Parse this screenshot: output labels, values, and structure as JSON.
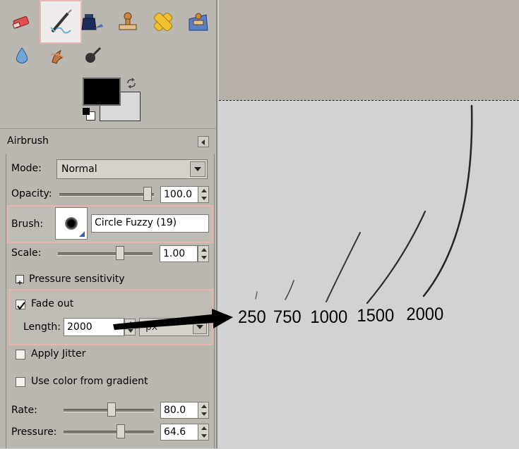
{
  "toolbox": {
    "tools": [
      {
        "name": "eraser-icon",
        "active": false
      },
      {
        "name": "airbrush-icon",
        "active": true
      },
      {
        "name": "ink-icon",
        "active": false
      },
      {
        "name": "clone-stamp-icon",
        "active": false
      },
      {
        "name": "heal-icon",
        "active": false
      },
      {
        "name": "perspective-clone-icon",
        "active": false
      },
      {
        "name": "blur-sharpen-icon",
        "active": false
      },
      {
        "name": "smudge-icon",
        "active": false
      },
      {
        "name": "dodge-burn-icon",
        "active": false
      }
    ],
    "foreground_color": "#000000",
    "background_color": "#d9d9d9"
  },
  "options": {
    "title": "Airbrush",
    "mode_label": "Mode:",
    "mode_value": "Normal",
    "opacity_label": "Opacity:",
    "opacity_value": "100.0",
    "opacity_level": 1.0,
    "brush_label": "Brush:",
    "brush_value": "Circle Fuzzy (19)",
    "scale_label": "Scale:",
    "scale_value": "1.00",
    "scale_level": 0.6,
    "pressure_sensitivity_label": "Pressure sensitivity",
    "fade_out_label": "Fade out",
    "fade_out_checked": true,
    "length_label": "Length:",
    "length_value": "2000",
    "unit_value": "px",
    "apply_jitter_label": "Apply Jitter",
    "use_gradient_label": "Use color from gradient",
    "rate_label": "Rate:",
    "rate_value": "80.0",
    "rate_level": 0.55,
    "pressure_label": "Pressure:",
    "pressure_value": "64.6",
    "pressure_level": 0.6
  },
  "canvas": {
    "stroke_labels": [
      "250",
      "750",
      "1000",
      "1500",
      "2000"
    ]
  }
}
